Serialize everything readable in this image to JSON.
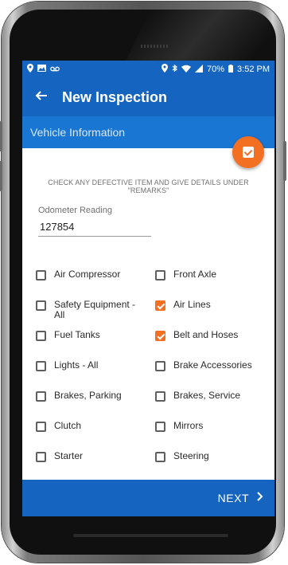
{
  "status_bar": {
    "left_icons": [
      "location-icon",
      "image-icon",
      "voicemail-icon"
    ],
    "right_icons": [
      "location-icon",
      "bluetooth-icon",
      "wifi-icon",
      "signal-icon"
    ],
    "battery": "70%",
    "time": "3:52 PM"
  },
  "app_bar": {
    "title": "New Inspection",
    "back_icon": "arrow-left-icon"
  },
  "section": {
    "title": "Vehicle Information"
  },
  "fab": {
    "icon": "checkbox-icon",
    "color": "#f36f21"
  },
  "instruction": "CHECK ANY DEFECTIVE ITEM AND GIVE DETAILS UNDER \"REMARKS\"",
  "odometer": {
    "label": "Odometer Reading",
    "value": "127854"
  },
  "checklist": [
    [
      {
        "label": "Air Compressor",
        "checked": false
      },
      {
        "label": "Front Axle",
        "checked": false
      }
    ],
    [
      {
        "label": "Safety Equipment - All",
        "checked": false
      },
      {
        "label": "Air Lines",
        "checked": true
      }
    ],
    [
      {
        "label": "Fuel Tanks",
        "checked": false
      },
      {
        "label": "Belt and Hoses",
        "checked": true
      }
    ],
    [
      {
        "label": "Lights - All",
        "checked": false
      },
      {
        "label": "Brake Accessories",
        "checked": false
      }
    ],
    [
      {
        "label": "Brakes, Parking",
        "checked": false
      },
      {
        "label": "Brakes, Service",
        "checked": false
      }
    ],
    [
      {
        "label": "Clutch",
        "checked": false
      },
      {
        "label": "Mirrors",
        "checked": false
      }
    ],
    [
      {
        "label": "Starter",
        "checked": false
      },
      {
        "label": "Steering",
        "checked": false
      }
    ]
  ],
  "footer": {
    "next_label": "NEXT",
    "next_icon": "chevron-right-icon"
  },
  "colors": {
    "primary": "#1565c0",
    "section": "#1976d2",
    "accent": "#f36f21"
  }
}
